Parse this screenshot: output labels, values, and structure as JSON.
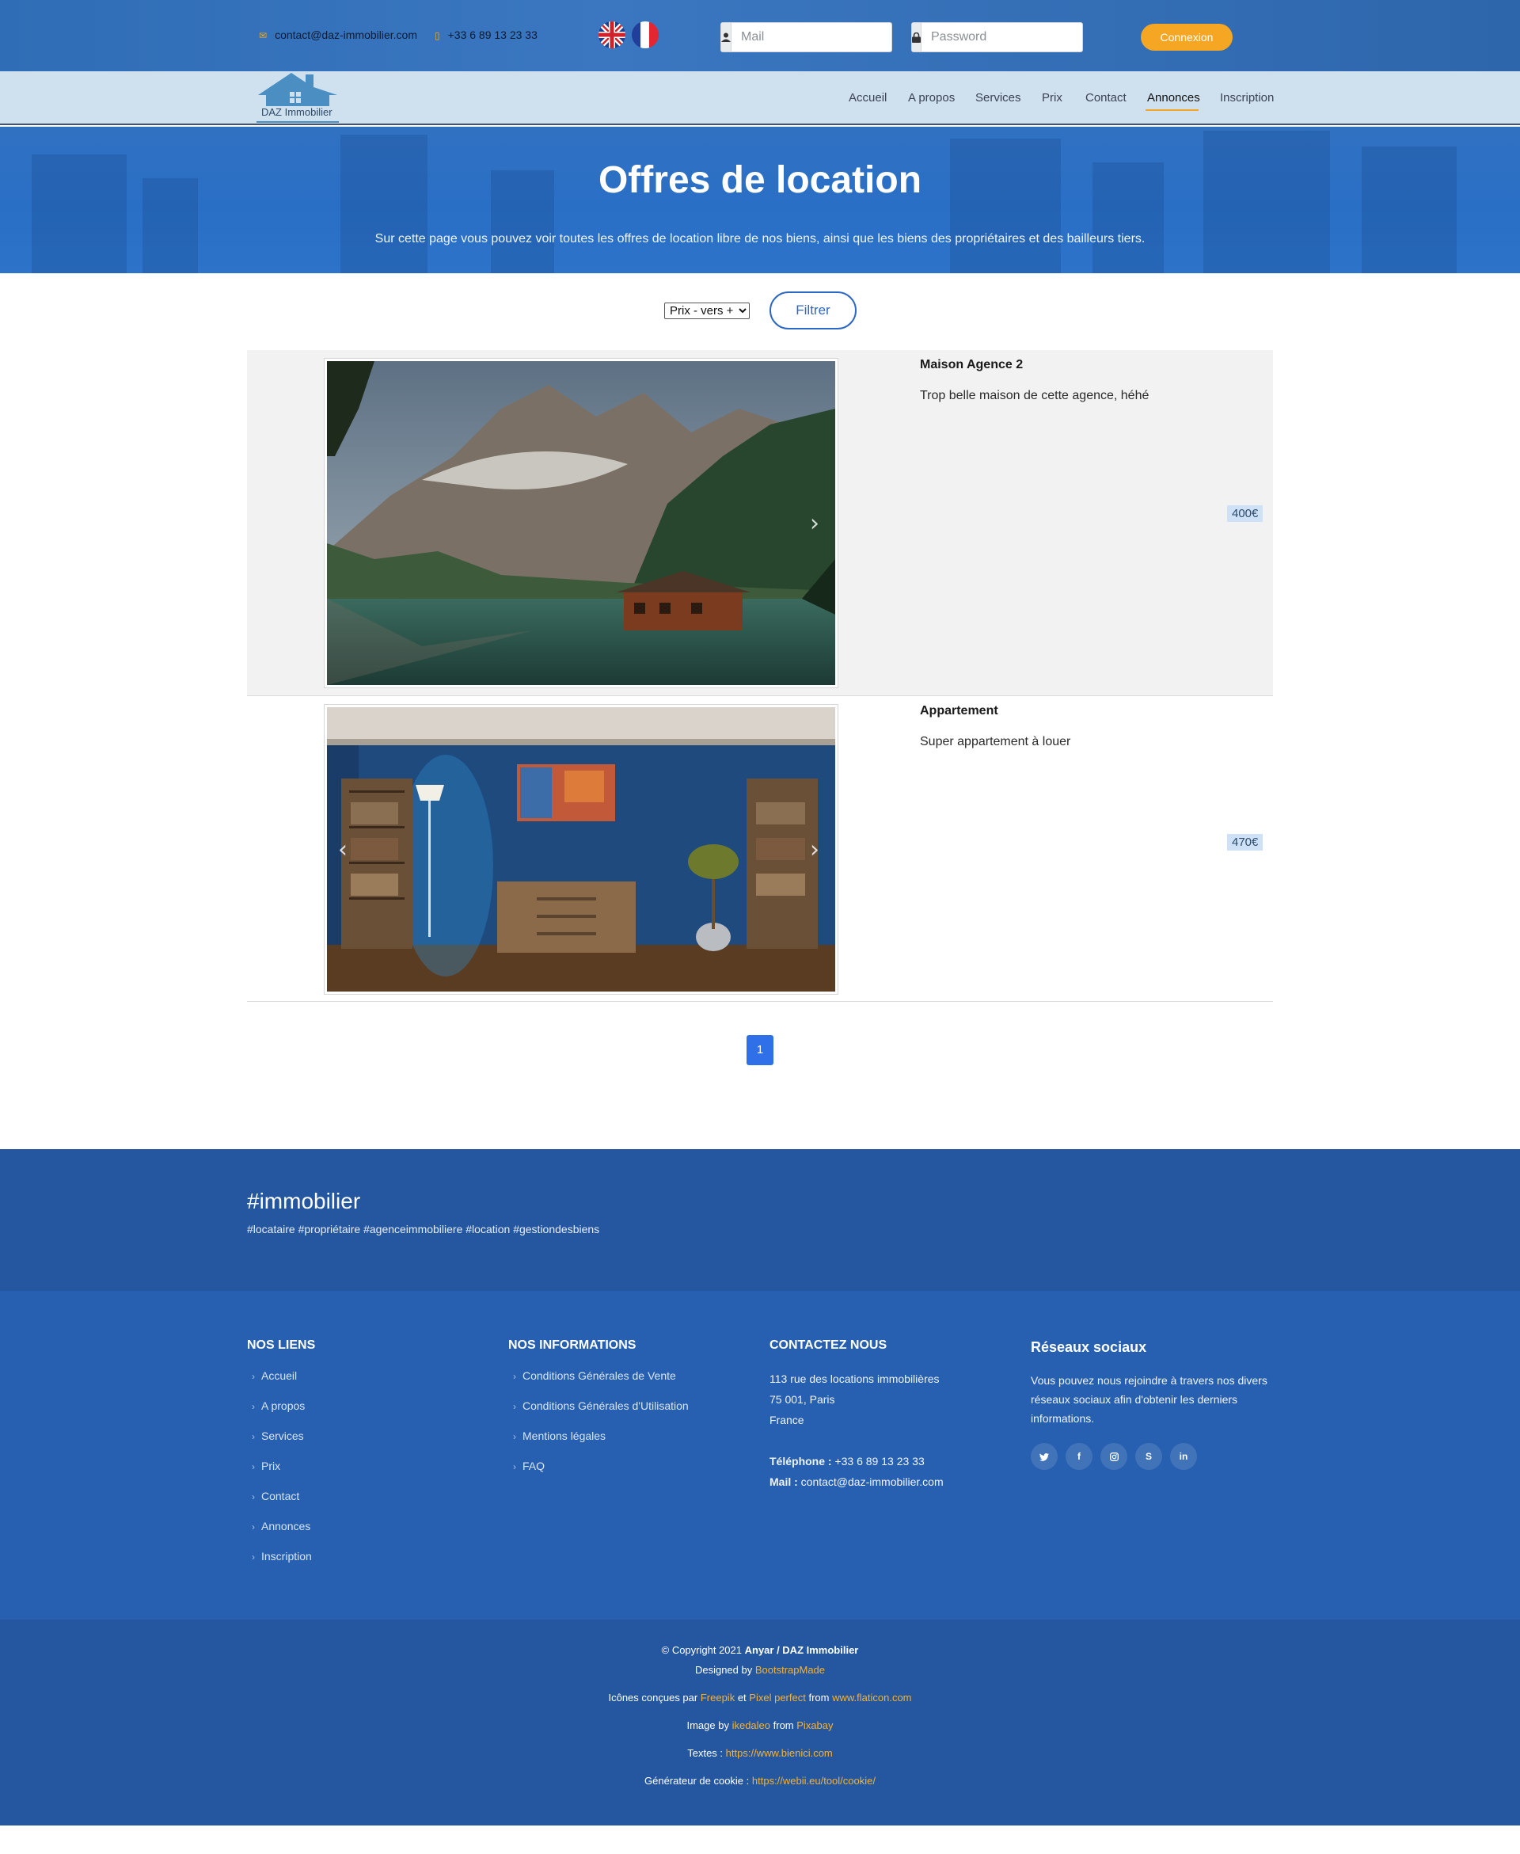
{
  "topbar": {
    "email": "contact@daz-immobilier.com",
    "phone": "+33 6 89 13 23 33",
    "mail_placeholder": "Mail",
    "password_placeholder": "Password",
    "login_label": "Connexion"
  },
  "nav": {
    "logo_text": "DAZ Immobilier",
    "items": [
      "Accueil",
      "A propos",
      "Services",
      "Prix",
      "Contact",
      "Annonces",
      "Inscription"
    ],
    "active": "Annonces"
  },
  "hero": {
    "title": "Offres de location",
    "subtitle": "Sur cette page vous pouvez voir toutes les offres de location libre de nos biens, ainsi que les biens des propriétaires et des bailleurs tiers."
  },
  "filter": {
    "sort_selected": "Prix - vers +",
    "filter_label": "Filtrer"
  },
  "listings": [
    {
      "title": "Maison Agence 2",
      "description": "Trop belle maison de cette agence, héhé",
      "price": "400€"
    },
    {
      "title": "Appartement",
      "description": "Super appartement à louer",
      "price": "470€"
    }
  ],
  "pagination": {
    "current": "1"
  },
  "footer": {
    "hashtag_title": "#immobilier",
    "hashtags": "#locataire #propriétaire #agenceimmobiliere #location #gestiondesbiens",
    "links_title": "NOS LIENS",
    "links": [
      "Accueil",
      "A propos",
      "Services",
      "Prix",
      "Contact",
      "Annonces",
      "Inscription"
    ],
    "info_title": "NOS INFORMATIONS",
    "info_links": [
      "Conditions Générales de Vente",
      "Conditions Générales d'Utilisation",
      "Mentions légales",
      "FAQ"
    ],
    "contact_title": "CONTACTEZ NOUS",
    "address_line1": "113 rue des locations immobilières",
    "address_line2": "75 001, Paris",
    "address_line3": "France",
    "phone_label": "Téléphone :",
    "phone": "+33 6 89 13 23 33",
    "mail_label": "Mail :",
    "mail": "contact@daz-immobilier.com",
    "social_title": "Réseaux sociaux",
    "social_text": "Vous pouvez nous rejoindre à travers nos divers réseaux sociaux afin d'obtenir les derniers informations.",
    "social_icons": [
      "twitter-icon",
      "facebook-icon",
      "instagram-icon",
      "skype-icon",
      "linkedin-icon"
    ]
  },
  "copyright": {
    "line1_prefix": "© Copyright 2021",
    "line1_brand": "Anyar / DAZ Immobilier",
    "designed_by": "Designed by",
    "designed_by_link": "BootstrapMade",
    "icons_prefix": "Icônes conçues par",
    "icons_author1": "Freepik",
    "icons_and": "et",
    "icons_author2": "Pixel perfect",
    "icons_from": "from",
    "icons_site": "www.flaticon.com",
    "image_prefix": "Image by",
    "image_author": "ikedaleo",
    "image_from": "from",
    "image_site": "Pixabay",
    "texts_prefix": "Textes :",
    "texts_link": "https://www.bienici.com",
    "cookie_prefix": "Générateur de cookie :",
    "cookie_link": "https://webii.eu/tool/cookie/"
  },
  "colors": {
    "accent": "#f5a623",
    "nav_bg": "#cfe0ef",
    "footer_blue": "#2760b0",
    "primary_blue": "#2f6fe8"
  }
}
